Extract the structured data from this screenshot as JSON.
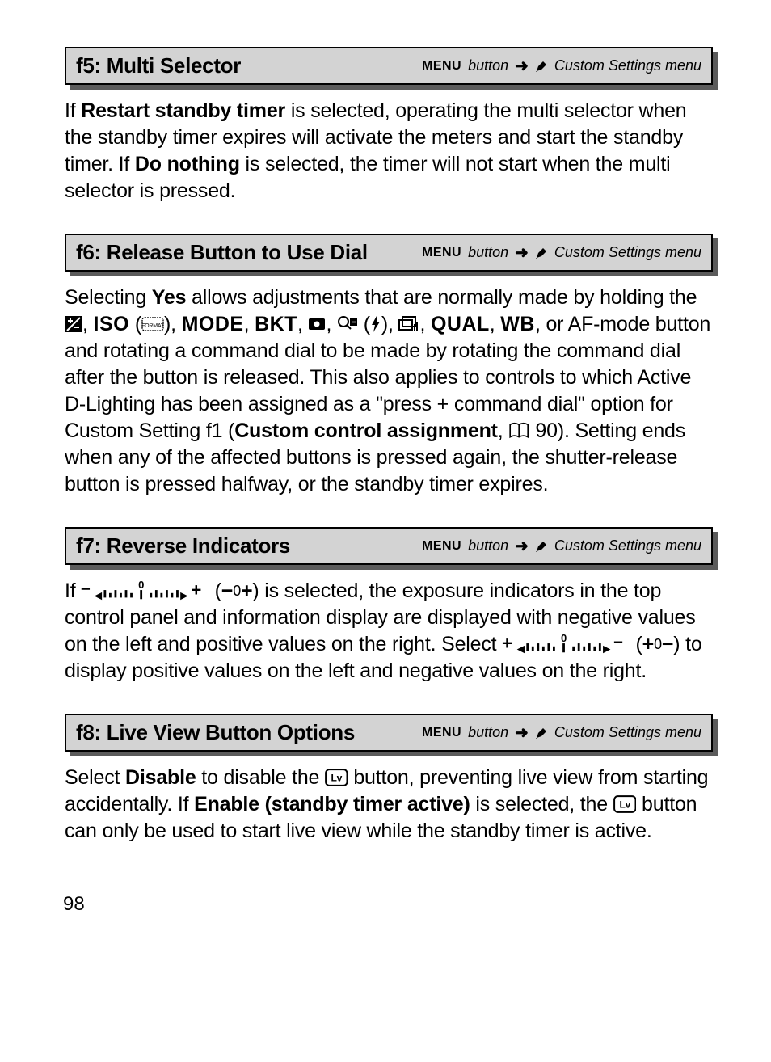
{
  "sections": {
    "f5": {
      "title": "f5: Multi Selector",
      "menu_button": "MENU",
      "button_word": "button",
      "arrow": "➜",
      "menu_label": "Custom Settings menu",
      "body_pre": "If ",
      "body_bold1": "Restart standby timer",
      "body_mid1": " is selected, operating the multi selector when the standby timer expires will activate the meters and start the standby timer.  If ",
      "body_bold2": "Do nothing",
      "body_end": " is selected, the timer will not start when the multi selector is pressed."
    },
    "f6": {
      "title": "f6: Release Button to Use Dial",
      "menu_button": "MENU",
      "button_word": "button",
      "arrow": "➜",
      "menu_label": "Custom Settings menu",
      "p1a": "Selecting ",
      "p1b": "Yes",
      "p1c": " allows adjustments that are normally made by holding the ",
      "iso": "ISO",
      "mode": "MODE",
      "bkt": "BKT",
      "qual": "QUAL",
      "wb": "WB",
      "p1d": ", or AF-mode button and rotating a command dial to be made by rotating the command dial after the button is released.  This also applies to controls to which Active D-Lighting has been assigned as a \"press + command dial\" option for Custom Setting f1 (",
      "p1e": "Custom control assignment",
      "p1f": ", ",
      "pageref": "90",
      "p1g": ").  Setting ends when any of the affected buttons is pressed again, the shutter-release button is pressed halfway, or the standby timer expires."
    },
    "f7": {
      "title": "f7: Reverse Indicators",
      "menu_button": "MENU",
      "button_word": "button",
      "arrow": "➜",
      "menu_label": "Custom Settings menu",
      "p_a": "If  ",
      "neg_pos_short": "0",
      "p_b": ") is selected, the exposure indicators in the top control panel and information display are displayed with negative values on the left and positive values on the right.  Select ",
      "pos_neg_short": "0",
      "p_c": ") to display positive values on the left and negative values on the right."
    },
    "f8": {
      "title": "f8: Live View Button Options",
      "menu_button": "MENU",
      "button_word": "button",
      "arrow": "➜",
      "menu_label": "Custom Settings menu",
      "p_a": "Select ",
      "disable": "Disable",
      "p_b": " to disable the ",
      "p_c": " button, preventing live view from starting accidentally.  If ",
      "enable": "Enable (standby timer active)",
      "p_d": " is selected, the ",
      "p_e": " button can only be used to start live view while the standby timer is active."
    }
  },
  "page_number": "98"
}
